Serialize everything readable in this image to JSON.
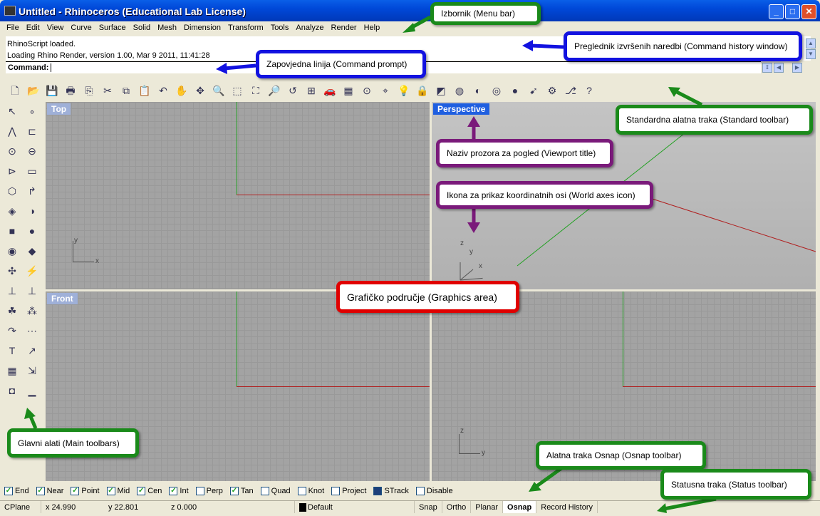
{
  "window": {
    "title": "Untitled - Rhinoceros (Educational Lab License)",
    "controls": [
      "_",
      "□",
      "✕"
    ]
  },
  "menu": [
    "File",
    "Edit",
    "View",
    "Curve",
    "Surface",
    "Solid",
    "Mesh",
    "Dimension",
    "Transform",
    "Tools",
    "Analyze",
    "Render",
    "Help"
  ],
  "history": [
    "RhinoScript loaded.",
    "Loading Rhino Render, version 1.00, Mar  9 2011, 11:41:28"
  ],
  "command": {
    "label": "Command:",
    "value": ""
  },
  "standard_toolbar": [
    "new-icon",
    "open-icon",
    "save-icon",
    "print-icon",
    "export-icon",
    "cut-icon",
    "copy-icon",
    "paste-icon",
    "undo-icon",
    "pan-icon",
    "rotate-icon",
    "zoom-icon",
    "zoom-window-icon",
    "zoom-extents-icon",
    "zoom-selected-icon",
    "undo-view-icon",
    "viewports-icon",
    "car-icon",
    "grid-icon",
    "cplane-icon",
    "osnap-icon",
    "light-icon",
    "lock-icon",
    "layer-icon",
    "color-icon",
    "shaded-icon",
    "wireframe-icon",
    "render-icon",
    "select-icon",
    "options-icon",
    "history-icon",
    "help-icon"
  ],
  "standard_glyphs": [
    "🗋",
    "📂",
    "💾",
    "🖶",
    "⎘",
    "✂",
    "⧉",
    "📋",
    "↶",
    "✋",
    "✥",
    "🔍",
    "⬚",
    "⛶",
    "🔎",
    "↺",
    "⊞",
    "🚗",
    "▦",
    "⊙",
    "⌖",
    "💡",
    "🔒",
    "◩",
    "◍",
    "◐",
    "◎",
    "●",
    "➹",
    "⚙",
    "⎇",
    "?"
  ],
  "main_toolbar_glyphs": [
    "↖",
    "∘",
    "⋀",
    "⊏",
    "⊙",
    "⊖",
    "⊳",
    "▭",
    "⬡",
    "↱",
    "◈",
    "◑",
    "■",
    "●",
    "◉",
    "◆",
    "✣",
    "⚡",
    "⊥",
    "⊥",
    "☘",
    "⁂",
    "↷",
    "⋯",
    "T",
    "↗",
    "▦",
    "⇲",
    "◘",
    "▁"
  ],
  "viewports": {
    "top": "Top",
    "perspective": "Perspective",
    "front": "Front"
  },
  "axes": {
    "x": "x",
    "y": "y",
    "z": "z"
  },
  "osnap": [
    {
      "label": "End",
      "checked": true
    },
    {
      "label": "Near",
      "checked": true
    },
    {
      "label": "Point",
      "checked": true
    },
    {
      "label": "Mid",
      "checked": true
    },
    {
      "label": "Cen",
      "checked": true
    },
    {
      "label": "Int",
      "checked": true
    },
    {
      "label": "Perp",
      "checked": false
    },
    {
      "label": "Tan",
      "checked": true
    },
    {
      "label": "Quad",
      "checked": false
    },
    {
      "label": "Knot",
      "checked": false
    },
    {
      "label": "Project",
      "checked": false
    },
    {
      "label": "STrack",
      "checked": false
    },
    {
      "label": "Disable",
      "checked": false
    }
  ],
  "status": {
    "cplane": "CPlane",
    "x": "x 24.990",
    "y": "y 22.801",
    "z": "z 0.000",
    "layer": "Default",
    "layer_color": "#000000",
    "buttons": [
      "Snap",
      "Ortho",
      "Planar",
      "Osnap",
      "Record History"
    ],
    "active": "Osnap"
  },
  "callouts": {
    "menu": "Izbornik (Menu bar)",
    "history": "Preglednik izvršenih naredbi (Command history window)",
    "command": "Zapovjedna linija (Command prompt)",
    "standard": "Standardna alatna traka (Standard toolbar)",
    "vptitle": "Naziv prozora za pogled (Viewport title)",
    "axes": "Ikona za prikaz koordinatnih osi (World axes icon)",
    "graphics": "Grafičko područje (Graphics area)",
    "main": "Glavni alati (Main toolbars)",
    "osnap": "Alatna traka Osnap (Osnap toolbar)",
    "statusbar": "Statusna traka (Status toolbar)"
  },
  "colors": {
    "green": "#1a8a1a",
    "blue": "#1212e0",
    "purple": "#7a1a7a",
    "red": "#e00000",
    "x_axis": "#b02020",
    "y_axis": "#20a020"
  }
}
